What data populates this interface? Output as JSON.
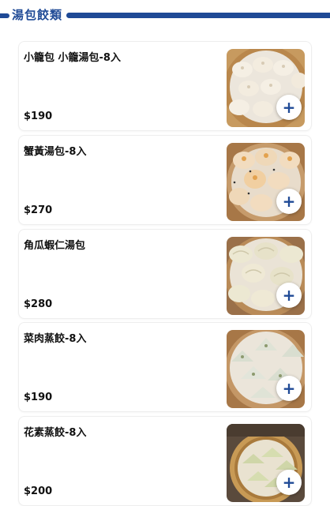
{
  "section": {
    "title": "湯包餃類"
  },
  "items": [
    {
      "name": "小籠包 小籠湯包-8入",
      "price": "$190",
      "icon": "xiaolongbao-photo"
    },
    {
      "name": "蟹黃湯包-8入",
      "price": "$270",
      "icon": "crab-roe-dumpling-photo"
    },
    {
      "name": "角瓜蝦仁湯包",
      "price": "$280",
      "icon": "shrimp-dumpling-photo"
    },
    {
      "name": "菜肉蒸餃-8入",
      "price": "$190",
      "icon": "pork-veg-dumpling-photo"
    },
    {
      "name": "花素蒸餃-8入",
      "price": "$200",
      "icon": "veg-dumpling-photo"
    }
  ],
  "add_label": "+",
  "colors": {
    "accent": "#1f4a96",
    "bamboo": "#c79a5f"
  }
}
